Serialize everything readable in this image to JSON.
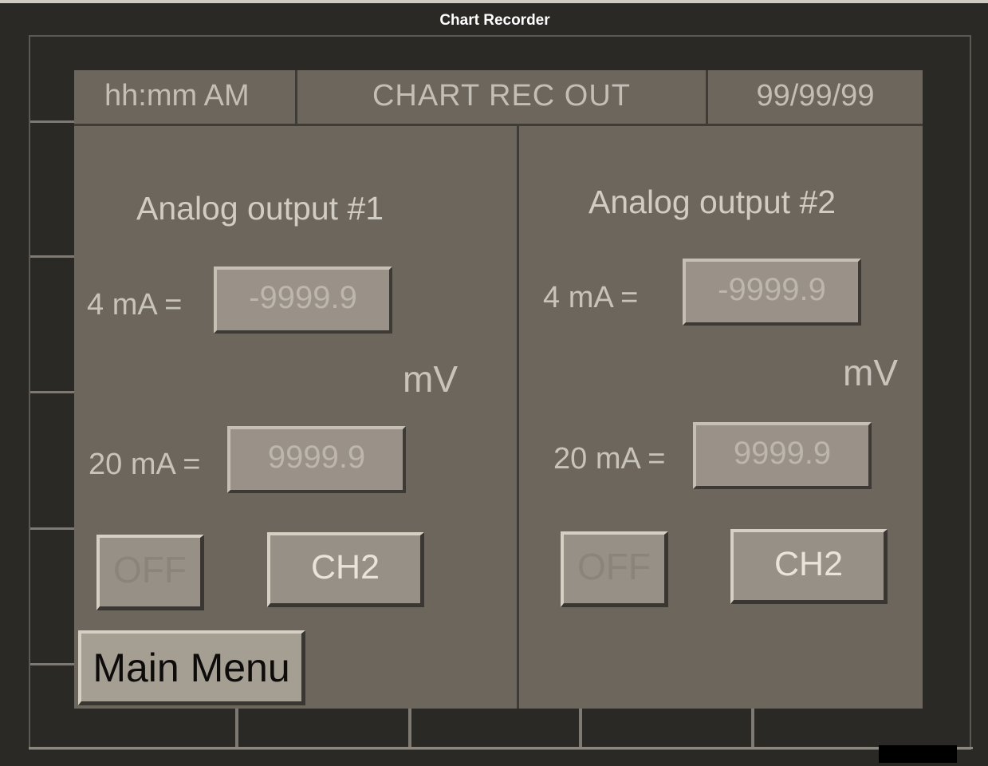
{
  "window": {
    "title": "Chart Recorder"
  },
  "header": {
    "time": "hh:mm AM",
    "title": "CHART REC OUT",
    "date": "99/99/99"
  },
  "outputs": [
    {
      "title": "Analog output #1",
      "low_label": "4 mA =",
      "low_value": "-9999.9",
      "unit": "mV",
      "high_label": "20 mA =",
      "high_value": "9999.9",
      "off_label": "OFF",
      "channel_label": "CH2"
    },
    {
      "title": "Analog output #2",
      "low_label": "4 mA =",
      "low_value": "-9999.9",
      "unit": "mV",
      "high_label": "20 mA =",
      "high_value": "9999.9",
      "off_label": "OFF",
      "channel_label": "CH2"
    }
  ],
  "footer": {
    "main_menu_label": "Main Menu"
  }
}
